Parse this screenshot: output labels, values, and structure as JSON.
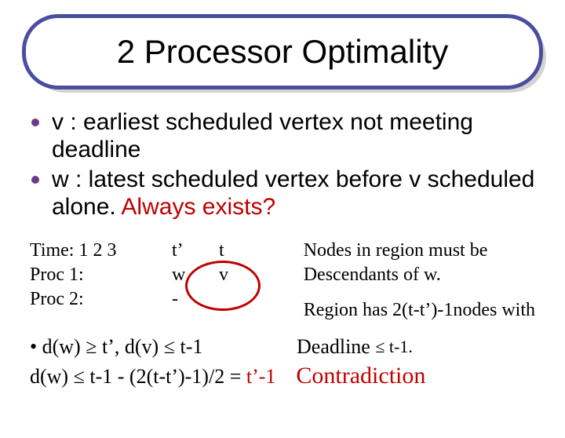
{
  "title": "2 Processor Optimality",
  "bullets": {
    "b1_a": "v : earliest scheduled vertex not meeting deadline",
    "b2_a": "w : latest scheduled vertex before v scheduled alone. ",
    "b2_red": "Always exists?"
  },
  "left": {
    "time": "Time: 1 2 3",
    "p1": "Proc 1:",
    "p2": "Proc 2:"
  },
  "mid": {
    "r1c1": "t’",
    "r1c2": "t",
    "r2c1": "w",
    "r2c2": "v",
    "r3c1": " -"
  },
  "right": {
    "l1": "Nodes in region must be",
    "l2": "Descendants of w.",
    "l3": "Region has 2(t-t’)-1nodes with"
  },
  "concl": {
    "line1_a": " • d(w) ",
    "ge": "≥",
    "line1_b": " t’,  d(v) ",
    "le": "≤",
    "line1_c": " t-1",
    "deadline_a": "Deadline ",
    "deadline_b": " t-1.",
    "line2_a": "d(w) ",
    "line2_b": " t-1 - (2(t-t’)-1)/2 = ",
    "line2_red1": " t’-1",
    "line2_red2": "Contradiction"
  }
}
